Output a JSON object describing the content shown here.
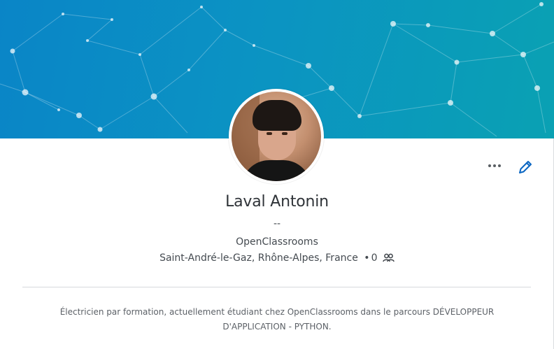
{
  "profile": {
    "name": "Laval Antonin",
    "headline": "--",
    "company": "OpenClassrooms",
    "location": "Saint-André-le-Gaz, Rhône-Alpes, France",
    "separator": "•",
    "connections": "0",
    "summary": "Électricien par formation, actuellement étudiant chez OpenClassrooms dans le parcours DÉVELOPPEUR D'APPLICATION - PYTHON."
  },
  "actions": {
    "more_icon": "more-horizontal-icon",
    "edit_icon": "pencil-icon"
  },
  "colors": {
    "banner_start": "#0a85c7",
    "banner_end": "#0aa1b3",
    "accent": "#0a66c2",
    "text_primary": "#2f3338",
    "text_secondary": "#444a50"
  }
}
